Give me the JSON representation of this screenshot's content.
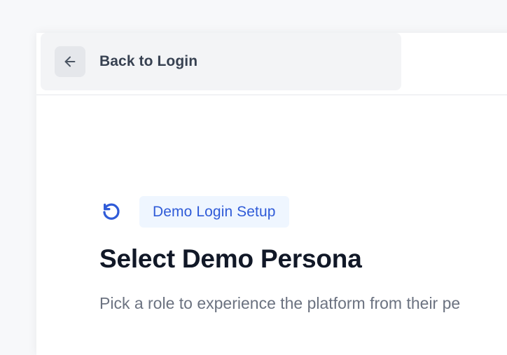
{
  "header": {
    "back_label": "Back to Login",
    "back_icon": "arrow-left-icon"
  },
  "hero": {
    "status_icon": "refresh-icon",
    "badge_label": "Demo Login Setup",
    "title": "Select Demo Persona",
    "subtitle": "Pick a role to experience the platform from their pe"
  },
  "colors": {
    "accent": "#2f5bd8",
    "badge_bg": "#eff6ff",
    "title": "#111827",
    "muted": "#6b7280",
    "back_bg": "#f3f4f6"
  }
}
